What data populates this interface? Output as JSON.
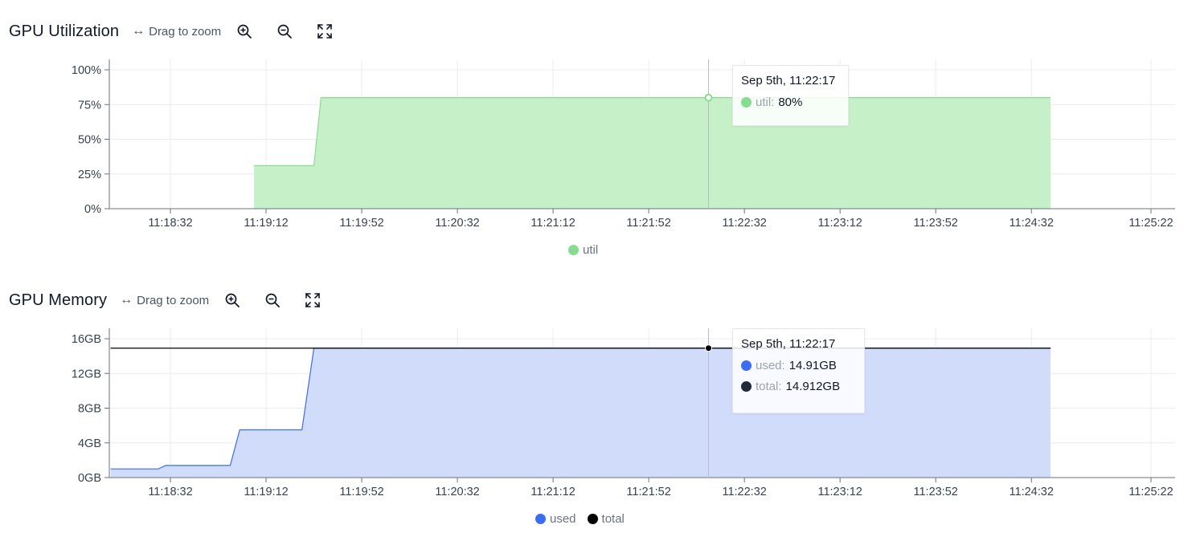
{
  "icons": {
    "zoom_in": "zoom-in-icon",
    "zoom_out": "zoom-out-icon",
    "fullscreen": "fullscreen-icon",
    "drag": "horizontal-arrows-icon"
  },
  "utilization": {
    "title": "GPU Utilization",
    "zoom_hint": "Drag to zoom",
    "tooltip": {
      "date": "Sep 5th, 11:22:17",
      "rows": [
        {
          "key": "util:",
          "value": "80%",
          "color": "#86dd8f"
        }
      ]
    },
    "legend": [
      {
        "label": "util",
        "color": "#86dd8f"
      }
    ]
  },
  "memory": {
    "title": "GPU Memory",
    "zoom_hint": "Drag to zoom",
    "tooltip": {
      "date": "Sep 5th, 11:22:17",
      "rows": [
        {
          "key": "used:",
          "value": "14.91GB",
          "color": "#3b6cf6"
        },
        {
          "key": "total:",
          "value": "14.912GB",
          "color": "#1f2937"
        }
      ]
    },
    "legend": [
      {
        "label": "used",
        "color": "#3b6cf6"
      },
      {
        "label": "total",
        "color": "#000000"
      }
    ]
  },
  "chart_data": [
    {
      "type": "area",
      "title": "GPU Utilization",
      "xlabel": "",
      "ylabel": "",
      "x_ticks": [
        "11:18:32",
        "11:19:12",
        "11:19:52",
        "11:20:32",
        "11:21:12",
        "11:21:52",
        "11:22:32",
        "11:23:12",
        "11:23:52",
        "11:24:32",
        "11:25:22"
      ],
      "y_ticks": [
        "0%",
        "25%",
        "50%",
        "75%",
        "100%"
      ],
      "ylim": [
        0,
        100
      ],
      "grid": true,
      "legend_position": "bottom-center",
      "series": [
        {
          "name": "util",
          "color": "#86dd8f",
          "fill": "#c6f0c8",
          "points": [
            [
              "11:19:07",
              31
            ],
            [
              "11:19:32",
              31
            ],
            [
              "11:19:35",
              80
            ],
            [
              "11:24:40",
              80
            ]
          ]
        }
      ]
    },
    {
      "type": "area",
      "title": "GPU Memory",
      "xlabel": "",
      "ylabel": "",
      "x_ticks": [
        "11:18:32",
        "11:19:12",
        "11:19:52",
        "11:20:32",
        "11:21:12",
        "11:21:52",
        "11:22:32",
        "11:23:12",
        "11:23:52",
        "11:24:32",
        "11:25:22"
      ],
      "y_ticks": [
        "0GB",
        "4GB",
        "8GB",
        "12GB",
        "16GB"
      ],
      "ylim": [
        0,
        16
      ],
      "grid": true,
      "legend_position": "bottom-center",
      "series": [
        {
          "name": "used",
          "color": "#3b6cf6",
          "fill": "#d1dcfb",
          "points": [
            [
              "11:18:07",
              1.0
            ],
            [
              "11:18:27",
              1.0
            ],
            [
              "11:18:30",
              1.4
            ],
            [
              "11:18:57",
              1.4
            ],
            [
              "11:19:01",
              5.5
            ],
            [
              "11:19:27",
              5.5
            ],
            [
              "11:19:32",
              14.91
            ],
            [
              "11:24:40",
              14.91
            ]
          ]
        },
        {
          "name": "total",
          "color": "#000000",
          "points": [
            [
              "11:18:07",
              14.912
            ],
            [
              "11:24:40",
              14.912
            ]
          ]
        }
      ]
    }
  ]
}
